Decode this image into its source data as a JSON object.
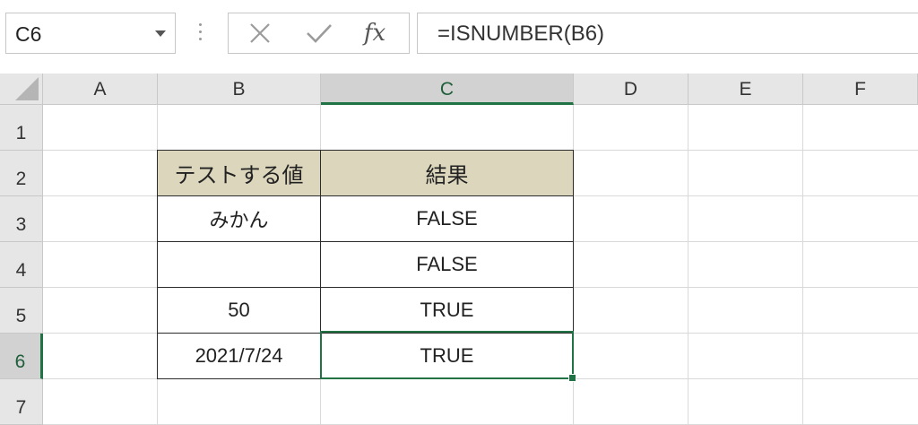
{
  "formula_bar": {
    "name_box": "C6",
    "cancel_icon": "close-icon",
    "enter_icon": "checkmark-icon",
    "fx_label": "fx",
    "formula": "=ISNUMBER(B6)"
  },
  "columns": [
    "A",
    "B",
    "C",
    "D",
    "E",
    "F"
  ],
  "rows": [
    "1",
    "2",
    "3",
    "4",
    "5",
    "6",
    "7"
  ],
  "selected_cell": "C6",
  "table": {
    "header": {
      "b": "テストする値",
      "c": "結果"
    },
    "rows": [
      {
        "b": "みかん",
        "c": "FALSE"
      },
      {
        "b": "",
        "c": "FALSE"
      },
      {
        "b": "50",
        "c": "TRUE"
      },
      {
        "b": "2021/7/24",
        "c": "TRUE"
      }
    ]
  },
  "colors": {
    "accent": "#217346",
    "table_header_fill": "#dcd6bd"
  }
}
